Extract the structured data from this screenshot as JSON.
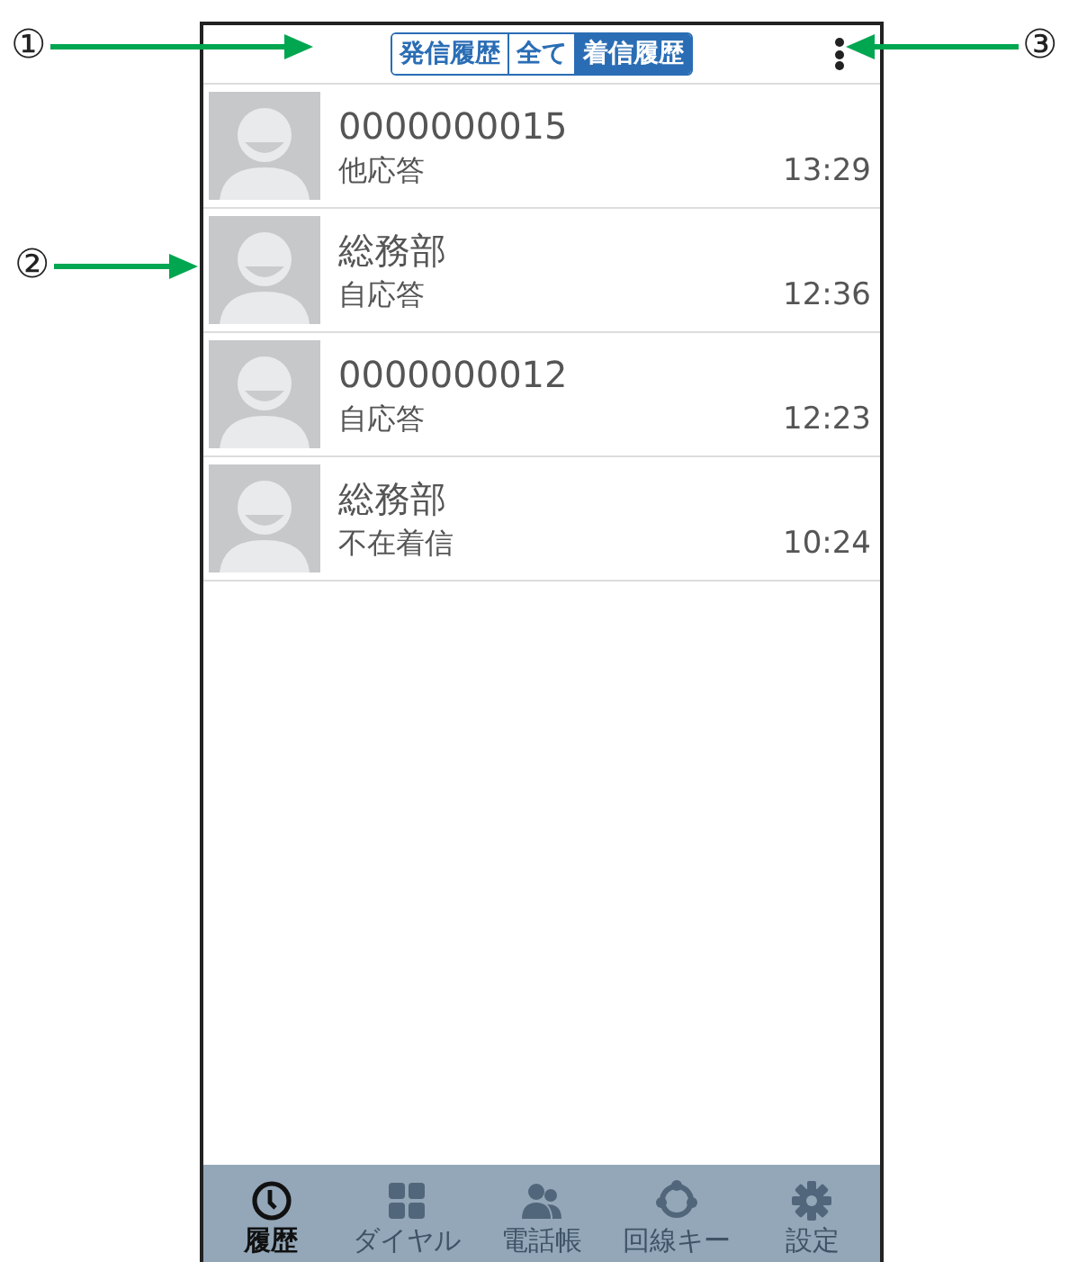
{
  "callouts": [
    {
      "label": "①"
    },
    {
      "label": "②"
    },
    {
      "label": "③"
    }
  ],
  "tabs": [
    {
      "label": "発信履歴",
      "selected": false
    },
    {
      "label": "全て",
      "selected": false
    },
    {
      "label": "着信履歴",
      "selected": true
    }
  ],
  "calls": [
    {
      "name": "0000000015",
      "type": "他応答",
      "time": "13:29"
    },
    {
      "name": "総務部",
      "type": "自応答",
      "time": "12:36"
    },
    {
      "name": "0000000012",
      "type": "自応答",
      "time": "12:23"
    },
    {
      "name": "総務部",
      "type": "不在着信",
      "time": "10:24"
    }
  ],
  "nav": [
    {
      "kind": "history",
      "label": "履歴",
      "selected": true
    },
    {
      "kind": "dial",
      "label": "ダイヤル",
      "selected": false
    },
    {
      "kind": "contacts",
      "label": "電話帳",
      "selected": false
    },
    {
      "kind": "line",
      "label": "回線キー",
      "selected": false
    },
    {
      "kind": "settings",
      "label": "設定",
      "selected": false
    }
  ]
}
